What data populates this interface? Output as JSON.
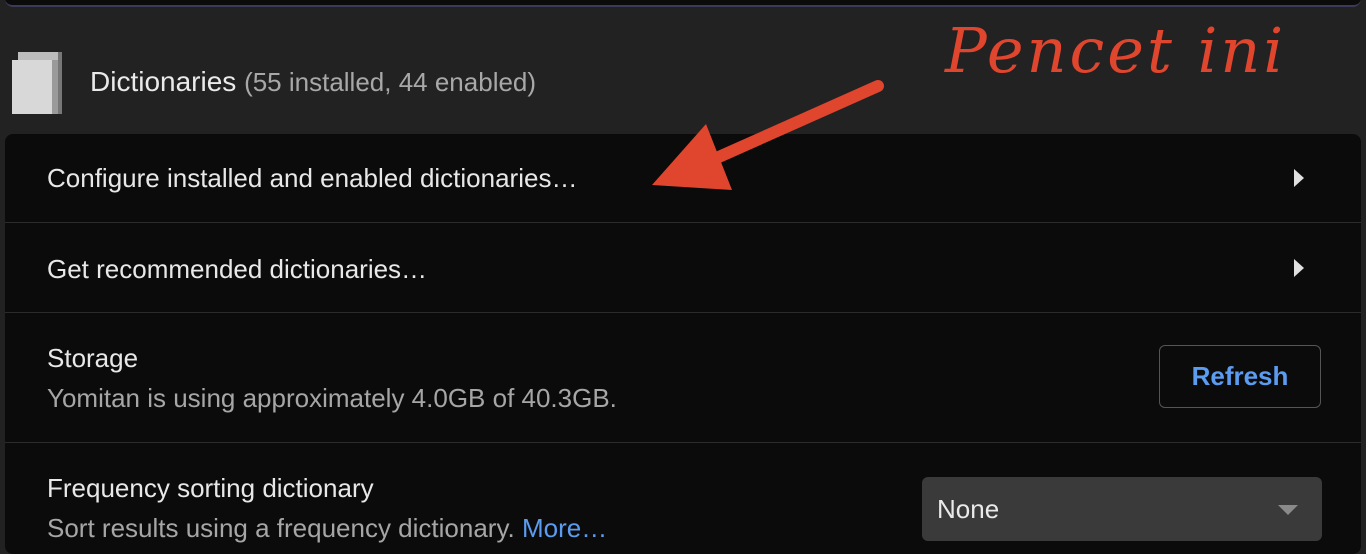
{
  "section": {
    "title": "Dictionaries",
    "count": "(55 installed, 44 enabled)",
    "icon": "book-icon"
  },
  "rows": {
    "configure": {
      "label": "Configure installed and enabled dictionaries…"
    },
    "recommended": {
      "label": "Get recommended dictionaries…"
    },
    "storage": {
      "label": "Storage",
      "description": "Yomitan is using approximately 4.0GB of 40.3GB.",
      "button": "Refresh"
    },
    "frequency": {
      "label": "Frequency sorting dictionary",
      "description": "Sort results using a frequency dictionary.",
      "link": "More…",
      "selected": "None"
    }
  },
  "annotation": {
    "text": "Pencet ini",
    "color": "#e0452e"
  },
  "colors": {
    "background": "#222222",
    "card": "#0b0b0b",
    "link": "#5b9bf0"
  }
}
